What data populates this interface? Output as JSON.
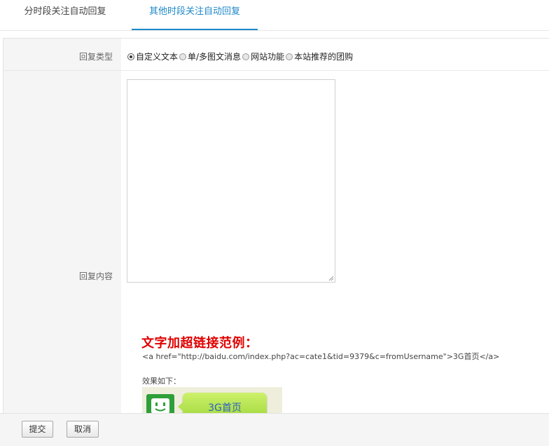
{
  "tabs": [
    {
      "label": "分时段关注自动回复",
      "active": false
    },
    {
      "label": "其他时段关注自动回复",
      "active": true
    }
  ],
  "form": {
    "reply_type_label": "回复类型",
    "reply_types": [
      {
        "label": "自定义文本",
        "checked": true
      },
      {
        "label": "单/多图文消息",
        "checked": false
      },
      {
        "label": "网站功能",
        "checked": false
      },
      {
        "label": "本站推荐的团购",
        "checked": false
      }
    ],
    "reply_content_label": "回复内容",
    "reply_content_value": ""
  },
  "example": {
    "title": "文字加超链接范例：",
    "code": "<a href=\"http://baidu.com/index.php?ac=cate1&tid=9379&c=fromUsername\">3G首页</a>",
    "effect_label": "效果如下：",
    "demo_link_text": "3G首页"
  },
  "buttons": {
    "submit": "提交",
    "cancel": "取消"
  },
  "colors": {
    "active_tab": "#1e88c9",
    "example_title": "#e00000",
    "demo_bubble": "#b5e351",
    "demo_icon": "#2f9f3a"
  }
}
